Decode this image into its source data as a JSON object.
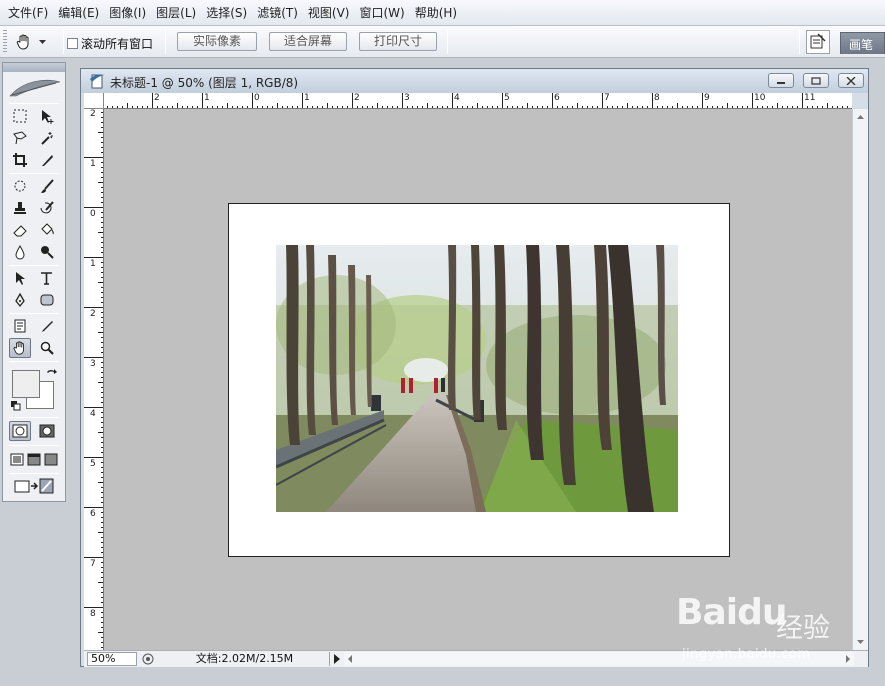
{
  "menu": [
    "文件(F)",
    "编辑(E)",
    "图像(I)",
    "图层(L)",
    "选择(S)",
    "滤镜(T)",
    "视图(V)",
    "窗口(W)",
    "帮助(H)"
  ],
  "options": {
    "scroll_all_label": "滚动所有窗口",
    "actual_pixels": "实际像素",
    "fit_screen": "适合屏幕",
    "print_size": "打印尺寸",
    "brush_tab": "画笔"
  },
  "document": {
    "title": "未标题-1 @ 50% (图层 1, RGB/8)",
    "zoom": "50%",
    "doc_size": "文档:2.02M/2.15M"
  },
  "rulers": {
    "horizontal_labels": [
      "2",
      "1",
      "0",
      "1",
      "2",
      "3",
      "4",
      "5",
      "6",
      "7",
      "8",
      "9",
      "10",
      "11",
      "12"
    ],
    "vertical_labels": [
      "2",
      "1",
      "0",
      "1",
      "2",
      "3",
      "4",
      "5",
      "6",
      "7",
      "8"
    ]
  },
  "watermark": {
    "logo": "Baidu",
    "cn": "经验",
    "url": "jingyan.baidu.com"
  },
  "colors": {
    "canvas_bg": "#c0c0c0",
    "title_bar": "#c3cfdd"
  }
}
